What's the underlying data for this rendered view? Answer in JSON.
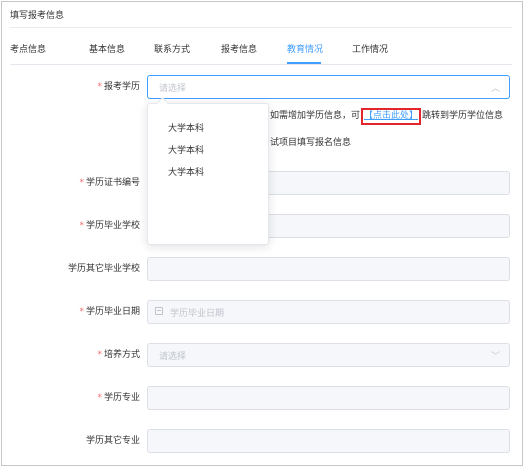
{
  "page_title": "填写报考信息",
  "tabs": [
    {
      "label": "考点信息"
    },
    {
      "label": "基本信息"
    },
    {
      "label": "联系方式"
    },
    {
      "label": "报考信息"
    },
    {
      "label": "教育情况"
    },
    {
      "label": "工作情况"
    }
  ],
  "active_tab": "教育情况",
  "form": {
    "education_level": {
      "label": "报考学历",
      "required": true,
      "placeholder": "请选择"
    },
    "certificate_no": {
      "label": "学历证书编号",
      "required": true
    },
    "grad_school": {
      "label": "学历毕业学校",
      "required": true
    },
    "other_grad_school": {
      "label": "学历其它毕业学校",
      "required": false
    },
    "grad_date": {
      "label": "学历毕业日期",
      "required": true,
      "placeholder": "学历毕业日期"
    },
    "study_mode": {
      "label": "培养方式",
      "required": true,
      "placeholder": "请选择"
    },
    "major": {
      "label": "学历专业",
      "required": true
    },
    "other_major": {
      "label": "学历其它专业",
      "required": false
    }
  },
  "notice": {
    "prefix": "如需增加学历信息，可",
    "link": "【点击此处】",
    "suffix": "跳转到学历学位信息",
    "line2": "试项目填写报名信息"
  },
  "dropdown": {
    "options": [
      "大学本科",
      "大学本科",
      "大学本科"
    ]
  },
  "icons": {
    "select_arrow": "chevron-down-icon",
    "date": "calendar-icon"
  },
  "colors": {
    "accent": "#409eff",
    "required": "#f56c6c",
    "highlight_box": "#e3262b"
  }
}
